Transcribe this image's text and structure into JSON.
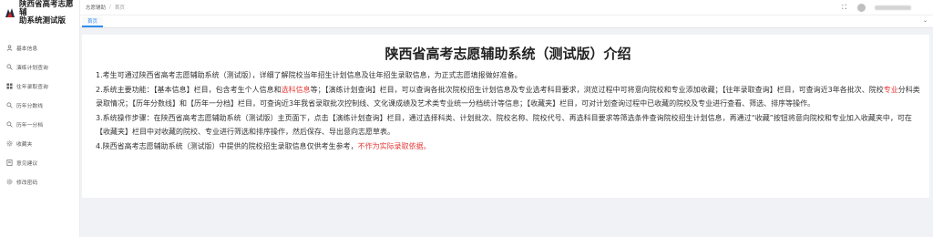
{
  "app": {
    "title_line1": "陕西省高考志愿辅",
    "title_line2": "助系统测试版"
  },
  "sidebar": {
    "items": [
      {
        "label": "基本信息",
        "icon": "user-icon"
      },
      {
        "label": "演练计划查询",
        "icon": "search-icon"
      },
      {
        "label": "往年录取查询",
        "icon": "grid-icon"
      },
      {
        "label": "历年分数线",
        "icon": "search-icon"
      },
      {
        "label": "历年一分档",
        "icon": "search-icon"
      },
      {
        "label": "收藏夹",
        "icon": "gear-icon"
      },
      {
        "label": "意见建议",
        "icon": "document-icon"
      },
      {
        "label": "修改密码",
        "icon": "gear-icon"
      }
    ]
  },
  "header": {
    "breadcrumb": {
      "root": "志愿辅助",
      "sep": "/",
      "current": "首页"
    },
    "fullscreen": "⛶"
  },
  "tabs": [
    {
      "label": "首页"
    }
  ],
  "content": {
    "title": "陕西省高考志愿辅助系统（测试版）介绍",
    "p1": "1.考生可通过陕西省高考志愿辅助系统（测试版），详细了解院校当年招生计划信息及往年招生录取信息，为正式志愿填报做好准备。",
    "p2a": "2.系统主要功能：【基本信息】栏目，包含考生个人信息和",
    "p2_red": "选科信息",
    "p2b": "等；【演练计划查询】栏目，可以查询各批次院校招生计划信息及专业选考科目要求，浏览过程中可将意向院校和专业添加收藏；【往年录取查询】栏目，可查询近3年各批次、院校",
    "p2_red2": "专业",
    "p2c": "分科类录取情况；【历年分数线】和【历年一分档】栏目，可查询近3年我省录取批次控制线、文化课成绩及艺术类专业统一分档统计等信息；【收藏夹】栏目，可对计划查询过程中已收藏的院校及专业进行查看、筛选、排序等操作。",
    "p3": "3.系统操作步骤：在陕西省高考志愿辅助系统（测试版）主页面下，点击【演练计划查询】栏目，通过选择科类、计划批次、院校名称、院校代号、再选科目要求等筛选条件查询院校招生计划信息，再通过“收藏”按钮将意向院校和专业加入收藏夹中，可在【收藏夹】栏目中对收藏的院校、专业进行筛选和排序操作，然后保存、导出意向志愿草表。",
    "p4a": "4.陕西省高考志愿辅助系统（测试版）中提供的院校招生录取信息仅供考生参考，",
    "p4_red": "不作为实际录取依据。"
  }
}
